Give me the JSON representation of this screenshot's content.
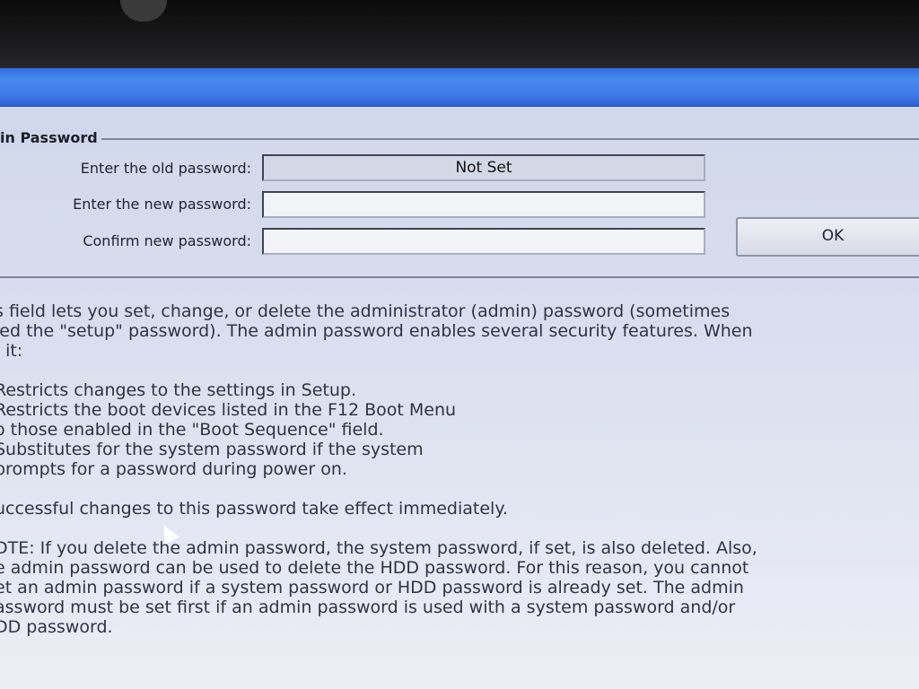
{
  "admin_password": {
    "group_title": "in Password",
    "old_password_label": "Enter the old password:",
    "old_password_value": "Not Set",
    "new_password_label": "Enter the new password:",
    "new_password_value": "",
    "confirm_password_label": "Confirm new password:",
    "confirm_password_value": "",
    "ok_label": "OK"
  },
  "help_text": {
    "intro": [
      "s field lets you set, change, or delete the administrator (admin) password (sometimes",
      "led the \"setup\" password).  The admin password enables several security features. When",
      ", it:"
    ],
    "features": [
      "Restricts changes to the settings in Setup.",
      "Restricts the boot devices listed in the F12 Boot Menu",
      "o those enabled in the \"Boot Sequence\" field.",
      "Substitutes for the system password if the system",
      "prompts for a password during power on."
    ],
    "effect": "uccessful changes to this password take effect immediately.",
    "note": [
      "DTE: If you delete the admin password, the system password, if set, is also deleted. Also,",
      "e admin password can be used to delete the HDD password.  For this reason, you cannot",
      "et an admin password if a system password or HDD password is already set. The admin",
      "assword must be set first if an admin password is used with a system password and/or",
      "DD password."
    ]
  }
}
